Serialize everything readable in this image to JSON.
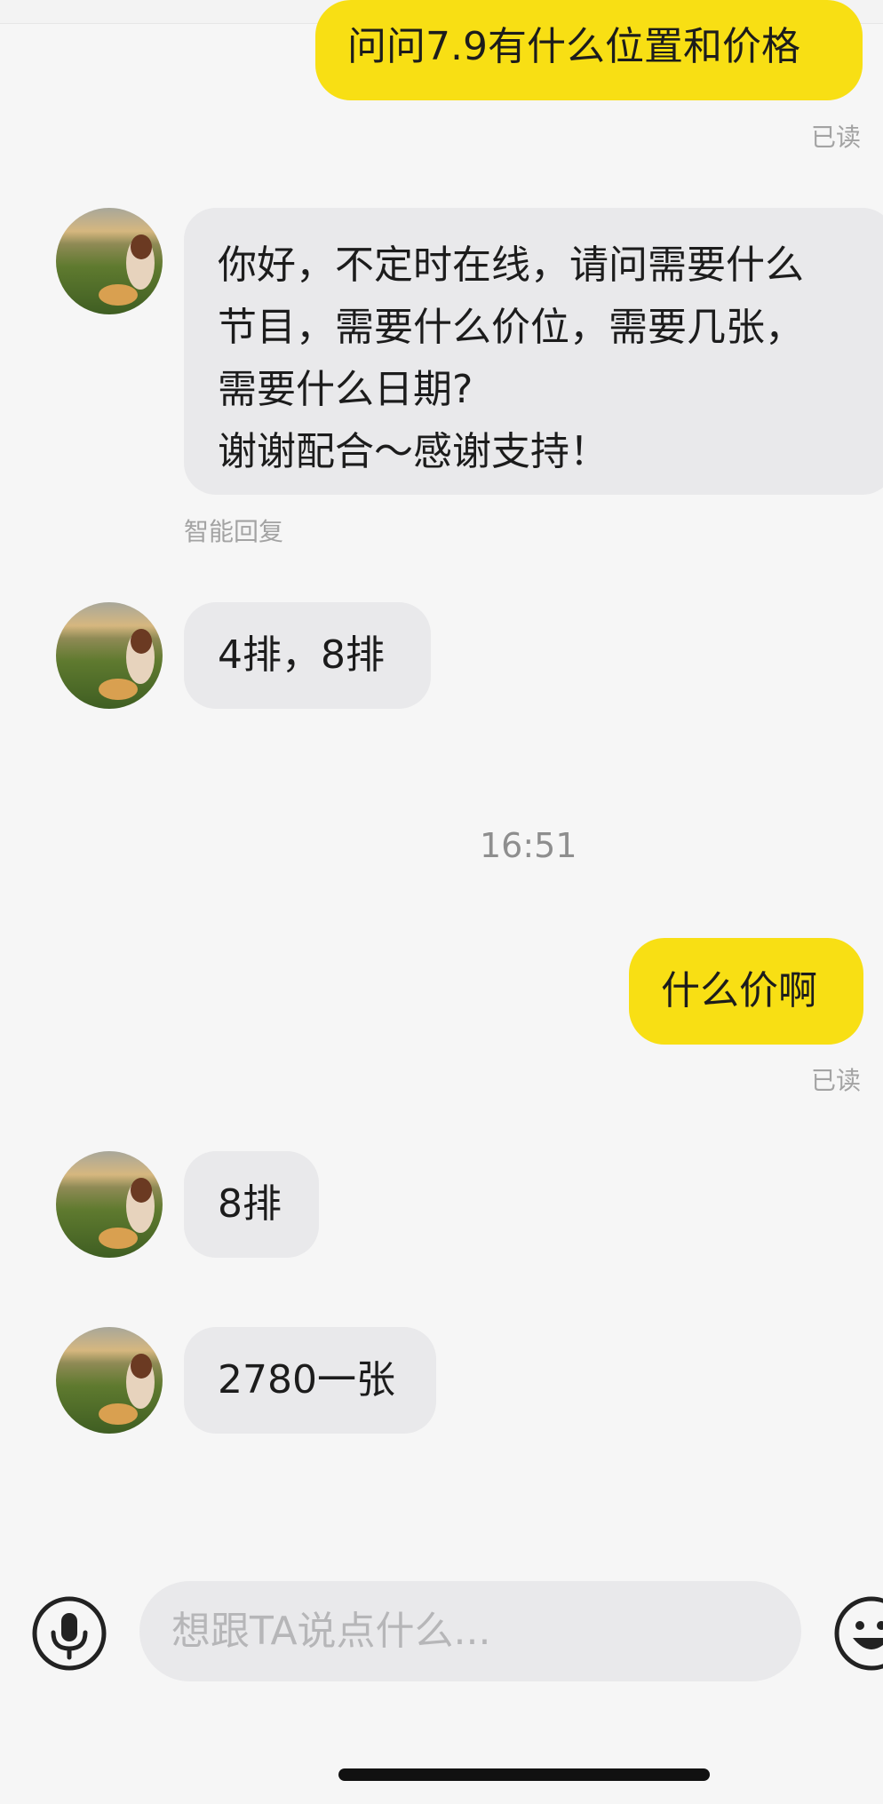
{
  "messages": {
    "out1": {
      "text": "问问7.9有什么位置和价格",
      "status": "已读"
    },
    "in1": {
      "lines": [
        "你好，不定时在线，请问需要什么",
        "节目，需要什么价位，需要几张，",
        "需要什么日期?",
        "谢谢配合～感谢支持！"
      ],
      "tag": "智能回复"
    },
    "in2": {
      "text": "4排，8排"
    },
    "time1": "16:51",
    "out2": {
      "text": "什么价啊",
      "status": "已读"
    },
    "in3": {
      "text": "8排"
    },
    "in4": {
      "text": "2780一张"
    }
  },
  "composer": {
    "placeholder": "想跟TA说点什么...",
    "voice_icon": "microphone-icon",
    "emoji_icon": "emoji-icon"
  },
  "colors": {
    "outgoing_bubble": "#f8df14",
    "incoming_bubble": "#e9e9eb",
    "background": "#f6f6f6"
  }
}
